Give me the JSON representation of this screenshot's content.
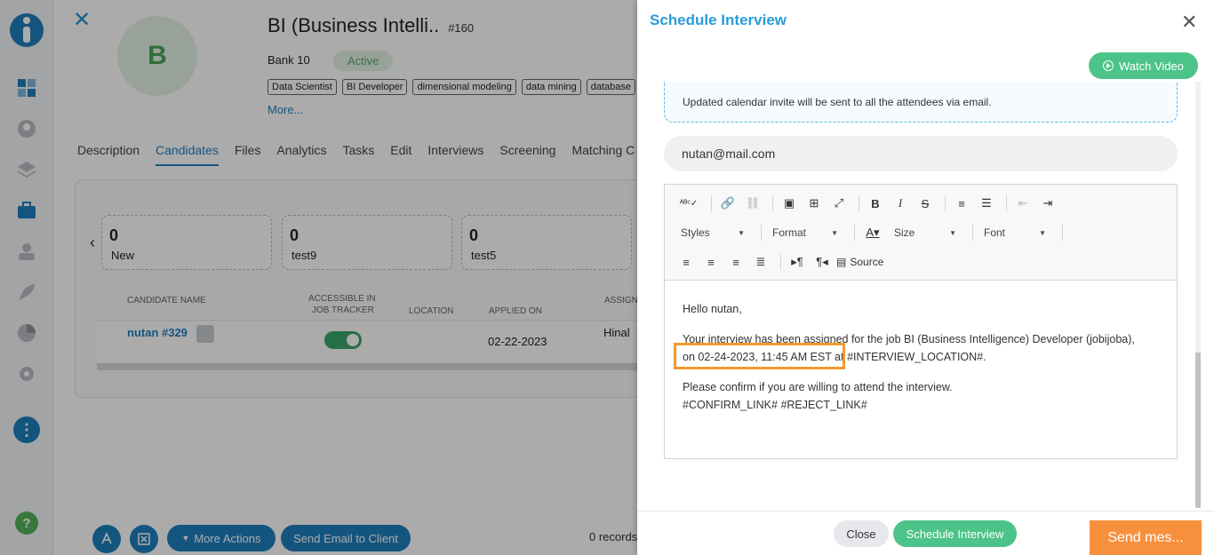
{
  "nav": {
    "icons": [
      "dashboard-icon",
      "contacts-icon",
      "layers-icon",
      "briefcase-icon",
      "user-icon",
      "rocket-icon",
      "pie-chart-icon",
      "gear-icon"
    ],
    "more": "⋮",
    "help": "?"
  },
  "job": {
    "avatar_letter": "B",
    "title": "BI (Business Intelli..",
    "id": "#160",
    "client": "Bank 10",
    "status": "Active",
    "tags": [
      "Data Scientist",
      "BI Developer",
      "dimensional modeling",
      "data mining",
      "database"
    ],
    "more_link": "More...",
    "tabs": [
      "Description",
      "Candidates",
      "Files",
      "Analytics",
      "Tasks",
      "Edit",
      "Interviews",
      "Screening",
      "Matching C"
    ],
    "active_tab": "Candidates"
  },
  "pipeline": {
    "stages": [
      {
        "count": "0",
        "name": "New"
      },
      {
        "count": "0",
        "name": "test9"
      },
      {
        "count": "0",
        "name": "test5"
      }
    ]
  },
  "table": {
    "headers": {
      "name": "CANDIDATE NAME",
      "tracker_line1": "ACCESSIBLE IN",
      "tracker_line2": "JOB TRACKER",
      "location": "LOCATION",
      "applied": "APPLIED ON",
      "assigned": "ASSIGNE"
    },
    "rows": [
      {
        "name": "nutan #329",
        "applied_on": "02-22-2023",
        "assignee": "Hinal",
        "tracker": true
      }
    ]
  },
  "bottom": {
    "more_actions": "More Actions",
    "send_email_client": "Send Email to Client",
    "records": "0 records"
  },
  "modal": {
    "title": "Schedule Interview",
    "watch_video": "Watch Video",
    "notice": "Updated calendar invite will be sent to all the attendees via email.",
    "to_email": "nutan@mail.com",
    "toolbar": {
      "styles": "Styles",
      "format": "Format",
      "size": "Size",
      "font": "Font",
      "source": "Source"
    },
    "body": {
      "greeting": "Hello nutan,",
      "line1": "Your interview has been assigned for the job BI (Business Intelligence) Developer (jobijoba),",
      "line2": "on 02-24-2023, 11:45 AM EST at #INTERVIEW_LOCATION#.",
      "line3": "Please confirm if you are willing to attend the interview.",
      "line4": "#CONFIRM_LINK# #REJECT_LINK#"
    },
    "close_label": "Close",
    "schedule_label": "Schedule Interview",
    "send_label": "Send mes..."
  }
}
